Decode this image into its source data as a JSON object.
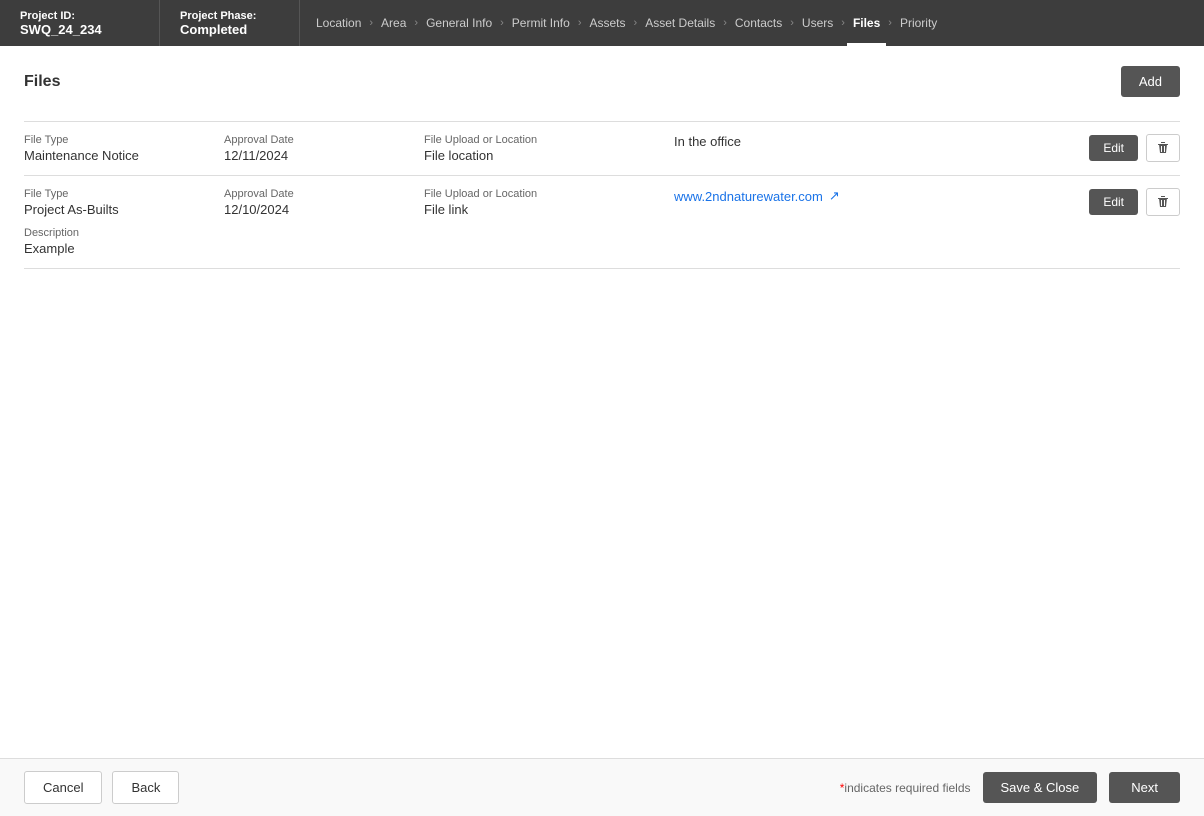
{
  "header": {
    "project_id_label": "Project ID:",
    "project_id_value": "SWQ_24_234",
    "phase_label": "Project Phase:",
    "phase_value": "Completed"
  },
  "nav": {
    "items": [
      {
        "label": "Location",
        "active": false
      },
      {
        "label": "Area",
        "active": false
      },
      {
        "label": "General Info",
        "active": false
      },
      {
        "label": "Permit Info",
        "active": false
      },
      {
        "label": "Assets",
        "active": false
      },
      {
        "label": "Asset Details",
        "active": false
      },
      {
        "label": "Contacts",
        "active": false
      },
      {
        "label": "Users",
        "active": false
      },
      {
        "label": "Files",
        "active": true
      },
      {
        "label": "Priority",
        "active": false
      }
    ]
  },
  "section": {
    "title": "Files",
    "add_button": "Add"
  },
  "files": [
    {
      "file_type_label": "File Type",
      "file_type_value": "Maintenance Notice",
      "approval_date_label": "Approval Date",
      "approval_date_value": "12/11/2024",
      "upload_location_label": "File Upload or Location",
      "upload_location_value": "File location",
      "location_value": "In the office",
      "has_link": false,
      "description_label": null,
      "description_value": null,
      "edit_label": "Edit",
      "delete_label": "Delete"
    },
    {
      "file_type_label": "File Type",
      "file_type_value": "Project As-Builts",
      "approval_date_label": "Approval Date",
      "approval_date_value": "12/10/2024",
      "upload_location_label": "File Upload or Location",
      "upload_location_value": "File link",
      "location_value": "www.2ndnaturewater.com",
      "has_link": true,
      "description_label": "Description",
      "description_value": "Example",
      "edit_label": "Edit",
      "delete_label": "Delete"
    }
  ],
  "footer": {
    "cancel_label": "Cancel",
    "back_label": "Back",
    "required_note": "indicates required fields",
    "save_close_label": "Save & Close",
    "next_label": "Next"
  }
}
